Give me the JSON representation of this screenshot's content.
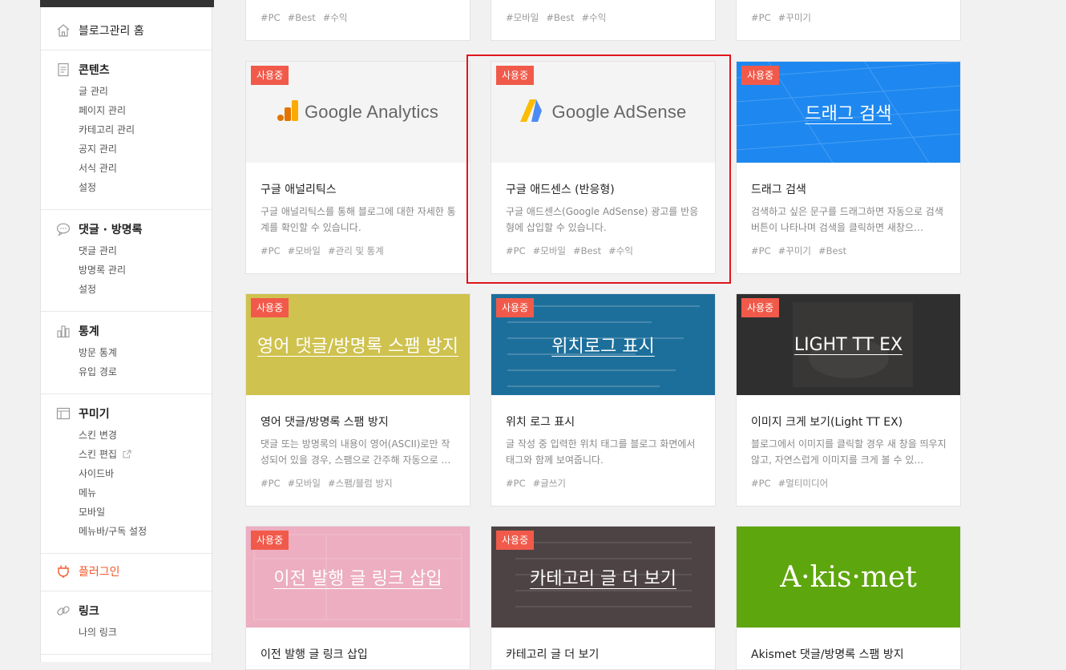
{
  "sidebar": {
    "home": "블로그관리 홈",
    "sections": [
      {
        "title": "콘텐츠",
        "items": [
          "글 관리",
          "페이지 관리",
          "카테고리 관리",
          "공지 관리",
          "서식 관리",
          "설정"
        ]
      },
      {
        "title": "댓글 · 방명록",
        "items": [
          "댓글 관리",
          "방명록 관리",
          "설정"
        ]
      },
      {
        "title": "통계",
        "items": [
          "방문 통계",
          "유입 경로"
        ]
      },
      {
        "title": "꾸미기",
        "items": [
          "스킨 변경",
          "스킨 편집",
          "사이드바",
          "메뉴",
          "모바일",
          "메뉴바/구독 설정"
        ]
      },
      {
        "title": "플러그인",
        "items": []
      },
      {
        "title": "링크",
        "items": [
          "나의 링크"
        ]
      }
    ]
  },
  "top_cards": [
    {
      "tags": [
        "#PC",
        "#Best",
        "#수익"
      ]
    },
    {
      "tags": [
        "#모바일",
        "#Best",
        "#수익"
      ]
    },
    {
      "tags": [
        "#PC",
        "#꾸미기"
      ]
    }
  ],
  "badge": "사용중",
  "cards": [
    {
      "banner": "Google Analytics",
      "title": "구글 애널리틱스",
      "desc": "구글 애널리틱스를 통해 블로그에 대한 자세한 통계를 확인할 수 있습니다.",
      "tags": [
        "#PC",
        "#모바일",
        "#관리 및 통계"
      ]
    },
    {
      "banner": "Google AdSense",
      "title": "구글 애드센스 (반응형)",
      "desc": "구글 애드센스(Google AdSense) 광고를 반응형에 삽입할 수 있습니다.",
      "tags": [
        "#PC",
        "#모바일",
        "#Best",
        "#수익"
      ]
    },
    {
      "banner": "드래그 검색",
      "title": "드래그 검색",
      "desc": "검색하고 싶은 문구를 드래그하면 자동으로 검색 버튼이 나타나며 검색을 클릭하면 새창으…",
      "tags": [
        "#PC",
        "#꾸미기",
        "#Best"
      ]
    },
    {
      "banner": "영어 댓글/방명록 스팸 방지",
      "title": "영어 댓글/방명록 스팸 방지",
      "desc": "댓글 또는 방명록의 내용이 영어(ASCII)로만 작성되어 있을 경우, 스팸으로 간주해 자동으로 …",
      "tags": [
        "#PC",
        "#모바일",
        "#스팸/블럼 방지"
      ]
    },
    {
      "banner": "위치로그 표시",
      "title": "위치 로그 표시",
      "desc": "글 작성 중 입력한 위치 태그를 블로그 화면에서 태그와 함께 보여줍니다.",
      "tags": [
        "#PC",
        "#글쓰기"
      ]
    },
    {
      "banner": "LIGHT TT EX",
      "title": "이미지 크게 보기(Light TT EX)",
      "desc": "블로그에서 이미지를 클릭할 경우 새 창을 띄우지 않고, 자연스럽게 이미지를 크게 볼 수 있…",
      "tags": [
        "#PC",
        "#멀티미디어"
      ]
    },
    {
      "banner": "이전 발행 글 링크 삽입",
      "title": "이전 발행 글 링크 삽입",
      "desc": "",
      "tags": []
    },
    {
      "banner": "카테고리 글 더 보기",
      "title": "카테고리 글 더 보기",
      "desc": "",
      "tags": []
    },
    {
      "banner": "A·kis·met",
      "title": "Akismet 댓글/방명록 스팸 방지",
      "desc": "",
      "tags": []
    }
  ],
  "colors": {
    "badge": "#f15a4a",
    "active": "#f15a2b",
    "highlight": "#e0161b",
    "drag_banner": "#1e88f0",
    "spam_banner": "#cfc24e",
    "location_banner": "#1d6f9b",
    "light_banner": "#2f2f2f",
    "prev_banner": "#ecaec0",
    "category_banner": "#4e4344",
    "akismet_banner": "#5ea60d"
  }
}
